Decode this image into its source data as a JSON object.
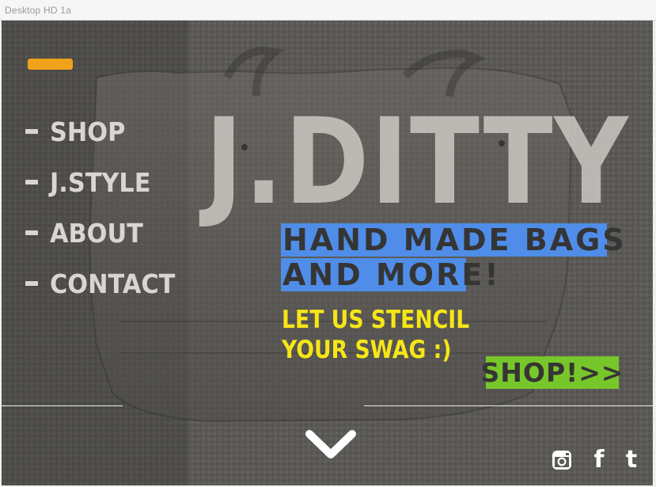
{
  "window": {
    "title": "Desktop HD 1a"
  },
  "hero": {
    "brand": "J.DITTY",
    "tagline_line1": "HAND MADE BAGS",
    "tagline_line2": "AND MORE!",
    "stencil_line1": "LET US STENCIL",
    "stencil_line2": "YOUR SWAG :)",
    "shop_button_label": "SHOP!>>"
  },
  "nav": {
    "items": [
      {
        "label": "SHOP"
      },
      {
        "label": "J.STYLE"
      },
      {
        "label": "ABOUT"
      },
      {
        "label": "CONTACT"
      }
    ]
  },
  "social": {
    "icons": [
      "instagram-icon",
      "facebook-icon",
      "tumblr-icon"
    ],
    "facebook_glyph": "f",
    "tumblr_glyph": "t"
  },
  "colors": {
    "accent_orange": "#f0a21b",
    "tagline_blue": "#4f8de8",
    "stencil_yellow": "#f6e616",
    "shop_green": "#78c72a",
    "nav_text": "#d9d6d1"
  },
  "icons": {
    "menu_accent": "menu-accent-bar",
    "scroll_down": "chevron-down-icon"
  }
}
